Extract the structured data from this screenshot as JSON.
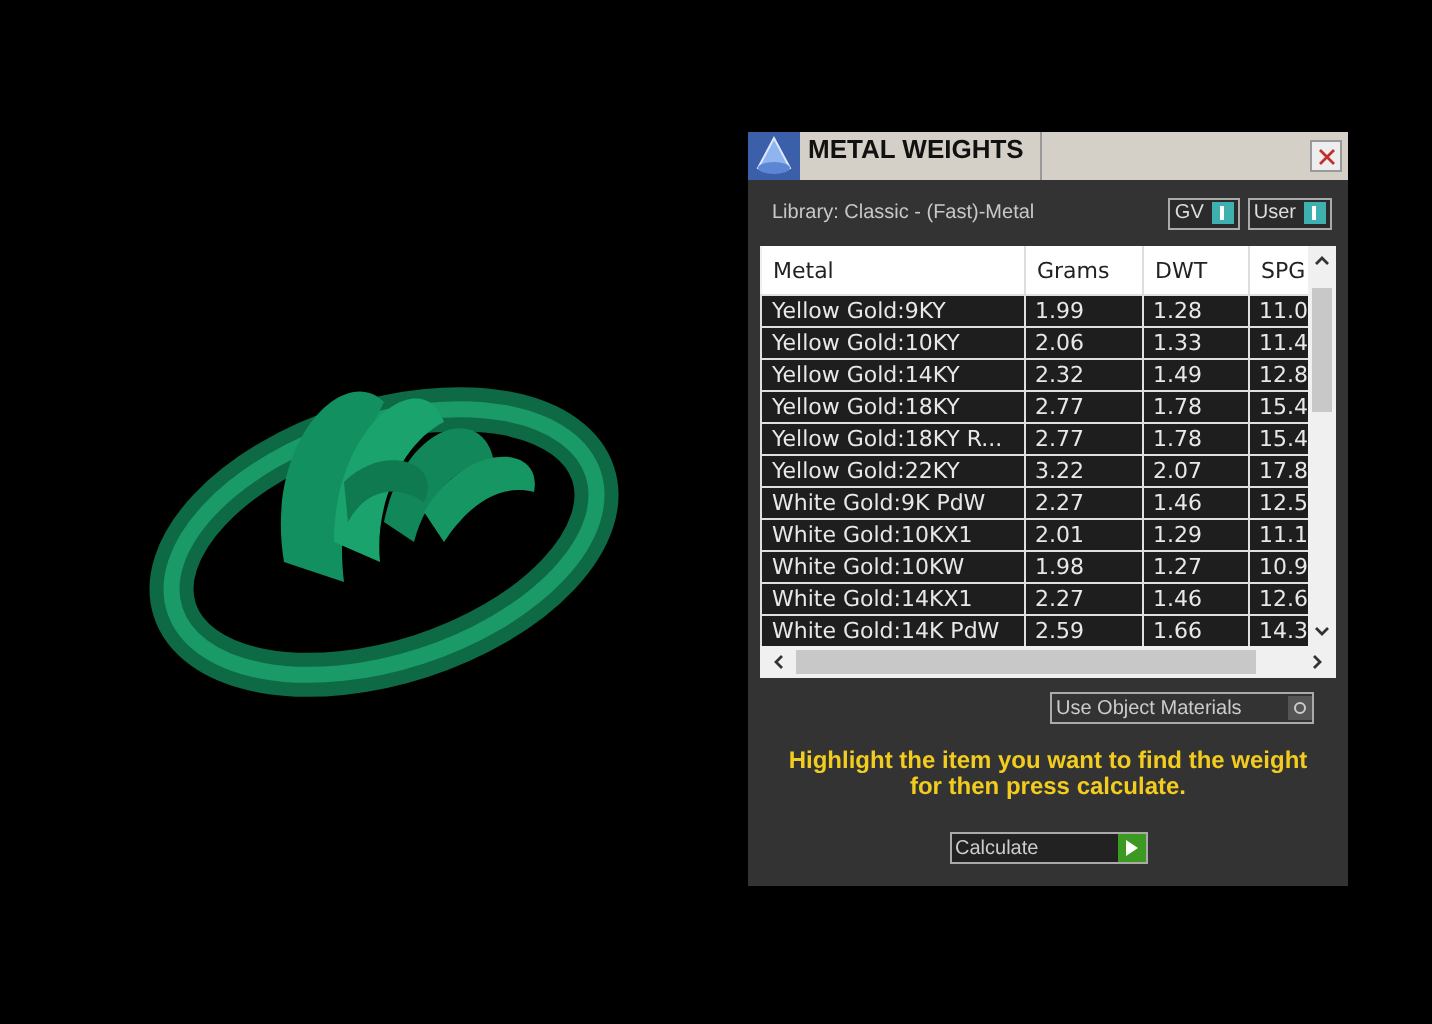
{
  "window": {
    "title": "METAL WEIGHTS"
  },
  "library": {
    "label": "Library: Classic - (Fast)-Metal"
  },
  "toggles": [
    {
      "label": "GV",
      "on": true
    },
    {
      "label": "User",
      "on": true
    }
  ],
  "table": {
    "columns": [
      "Metal",
      "Grams",
      "DWT",
      "SPG"
    ],
    "rows": [
      {
        "cells": [
          "Yellow Gold:9KY",
          "1.99",
          "1.28",
          "11.0"
        ]
      },
      {
        "cells": [
          "Yellow Gold:10KY",
          "2.06",
          "1.33",
          "11.4"
        ]
      },
      {
        "cells": [
          "Yellow Gold:14KY",
          "2.32",
          "1.49",
          "12.8"
        ]
      },
      {
        "cells": [
          "Yellow Gold:18KY",
          "2.77",
          "1.78",
          "15.4"
        ]
      },
      {
        "cells": [
          "Yellow Gold:18KY R...",
          "2.77",
          "1.78",
          "15.4"
        ]
      },
      {
        "cells": [
          "Yellow Gold:22KY",
          "3.22",
          "2.07",
          "17.8"
        ]
      },
      {
        "cells": [
          "White Gold:9K PdW",
          "2.27",
          "1.46",
          "12.5"
        ]
      },
      {
        "cells": [
          "White Gold:10KX1",
          "2.01",
          "1.29",
          "11.1"
        ]
      },
      {
        "cells": [
          "White Gold:10KW",
          "1.98",
          "1.27",
          "10.9"
        ]
      },
      {
        "cells": [
          "White Gold:14KX1",
          "2.27",
          "1.46",
          "12.6"
        ]
      },
      {
        "cells": [
          "White Gold:14K PdW",
          "2.59",
          "1.66",
          "14.3"
        ]
      }
    ]
  },
  "use_object_materials": {
    "label": "Use Object Materials",
    "on": false
  },
  "hint": "Highlight the item you want to find the weight for then press calculate.",
  "calculate_button": {
    "label": "Calculate"
  }
}
